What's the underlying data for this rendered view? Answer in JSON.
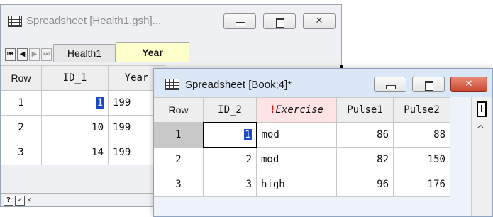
{
  "back_window": {
    "title": "Spreadsheet [Health1.gsh]...",
    "controls": {
      "minimize": "–",
      "maximize": "□",
      "close": "✕"
    },
    "tabs": [
      {
        "label": "Health1",
        "active": false
      },
      {
        "label": "Year",
        "active": true
      }
    ],
    "columns": [
      "Row",
      "ID_1",
      "Year"
    ],
    "rows": [
      {
        "row": "1",
        "id_1": "1",
        "year": "199"
      },
      {
        "row": "2",
        "id_1": "10",
        "year": "199"
      },
      {
        "row": "3",
        "id_1": "14",
        "year": "199"
      }
    ],
    "bottom": {
      "help": "?",
      "check": "✓",
      "scroll_left": "‹"
    }
  },
  "front_window": {
    "title": "Spreadsheet [Book;4]*",
    "controls": {
      "minimize": "–",
      "maximize": "□",
      "close": "✕"
    },
    "columns": [
      "Row",
      "ID_2",
      "Exercise",
      "Pulse1",
      "Pulse2"
    ],
    "exercise_flag": "!",
    "rows": [
      {
        "row": "1",
        "id_2": "1",
        "exercise": "mod",
        "pulse1": "86",
        "pulse2": "88"
      },
      {
        "row": "2",
        "id_2": "2",
        "exercise": "mod",
        "pulse1": "82",
        "pulse2": "150"
      },
      {
        "row": "3",
        "id_2": "3",
        "exercise": "high",
        "pulse1": "96",
        "pulse2": "176"
      }
    ],
    "scroll_up": "^"
  },
  "colors": {
    "row_header_text": "#2d3db5",
    "id2_header_text": "#1f8a3e",
    "exercise_header_bg": "#fde3e3",
    "active_tab_bg": "#ffffcc",
    "selection": "#1b49c8"
  }
}
